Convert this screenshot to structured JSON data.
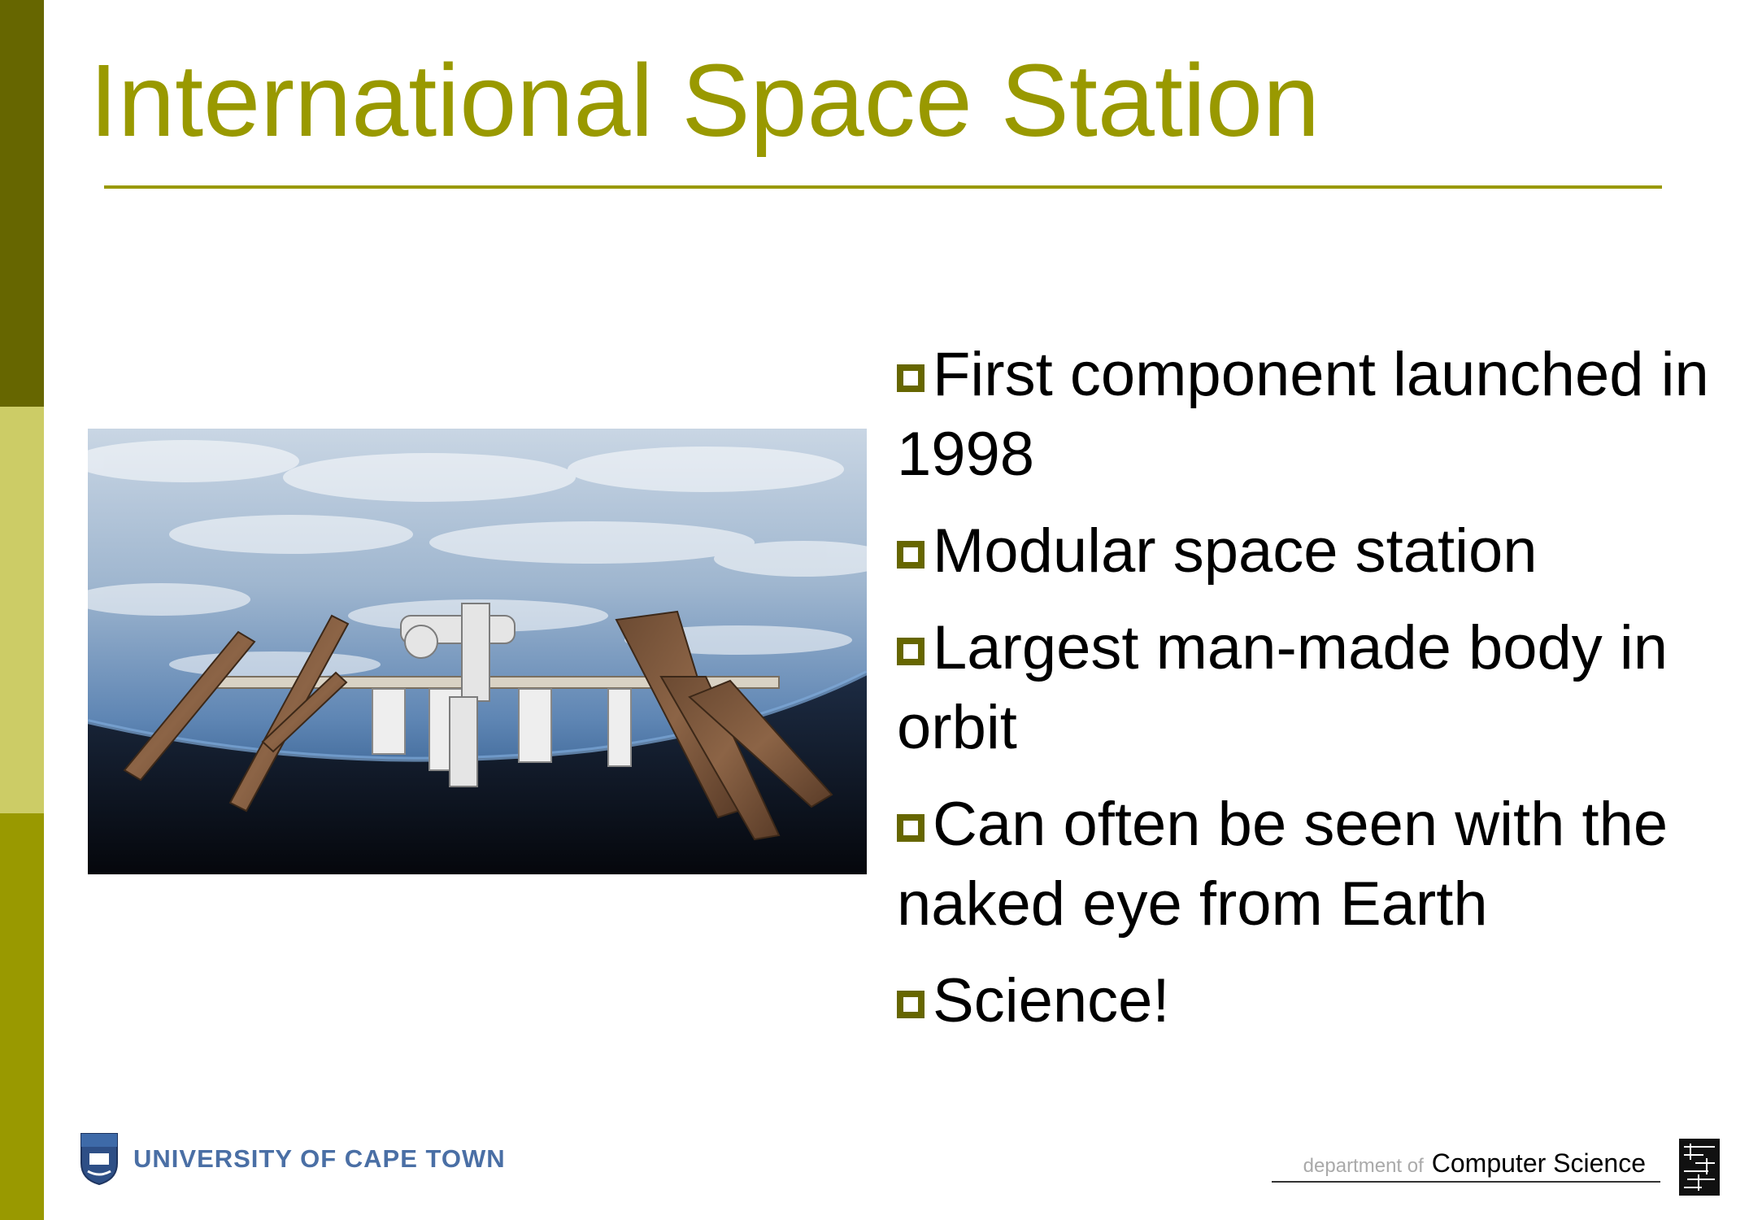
{
  "slide": {
    "title": "International Space Station",
    "bullets": [
      "First component launched in 1998",
      "Modular space station",
      "Largest man-made body in orbit",
      "Can often be seen with the naked eye from Earth",
      "Science!"
    ]
  },
  "footer": {
    "university": "UNIVERSITY OF CAPE TOWN",
    "department_prefix": "department of",
    "department_name": "Computer Science"
  },
  "colors": {
    "accent": "#999900",
    "sidebar_dark": "#666600",
    "sidebar_light": "#cccc66",
    "text": "#000000"
  },
  "images": {
    "photo": "international-space-station-over-earth"
  }
}
